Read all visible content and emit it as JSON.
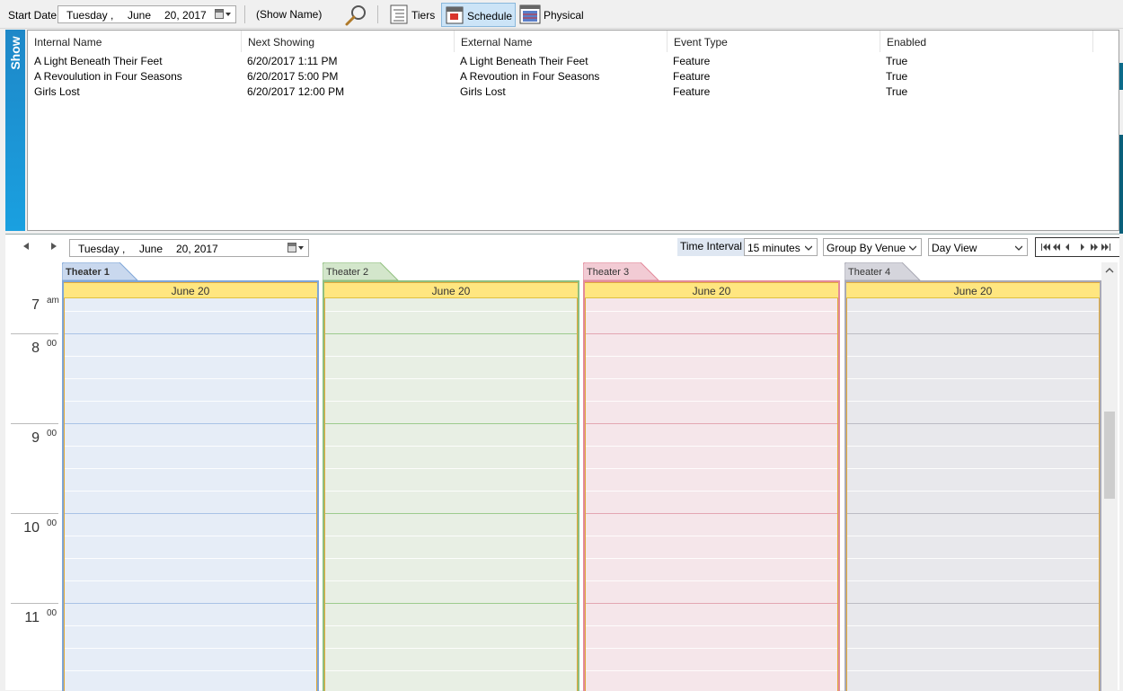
{
  "toolbar": {
    "start_date_label": "Start Date",
    "start_date": {
      "weekday": "Tuesday",
      "sep": ",",
      "month": "June",
      "day_year": "20, 2017"
    },
    "show_name": "(Show Name)",
    "tiers_label": "Tiers",
    "schedule_label": "Schedule",
    "physical_label": "Physical"
  },
  "show_panel": {
    "tab_label": "Show",
    "columns": [
      "Internal Name",
      "Next Showing",
      "External Name",
      "Event Type",
      "Enabled"
    ],
    "rows": [
      [
        "A Light Beneath Their Feet",
        "6/20/2017 1:11 PM",
        "A Light Beneath Their Feet",
        "Feature",
        "True"
      ],
      [
        "A Revoulution in Four Seasons",
        "6/20/2017 5:00 PM",
        "A Revoution in Four Seasons",
        "Feature",
        "True"
      ],
      [
        "Girls Lost",
        "6/20/2017 12:00 PM",
        "Girls Lost",
        "Feature",
        "True"
      ]
    ]
  },
  "scheduler": {
    "date": {
      "weekday": "Tuesday",
      "sep": ",",
      "month": "June",
      "day_year": "20, 2017"
    },
    "time_interval_label": "Time Interval",
    "interval_value": "15 minutes",
    "group_value": "Group By Venue",
    "view_value": "Day View",
    "theaters": [
      {
        "name": "Theater 1",
        "date": "June 20",
        "bg": "#e6edf7",
        "border": "#7fa6d8",
        "line": "#a9c3e6",
        "tab": "#c9d8ee"
      },
      {
        "name": "Theater 2",
        "date": "June 20",
        "bg": "#e8efe4",
        "border": "#8fbf7f",
        "line": "#9ccb8d",
        "tab": "#d3e6cb"
      },
      {
        "name": "Theater 3",
        "date": "June 20",
        "bg": "#f5e6ea",
        "border": "#e38a9a",
        "line": "#e3a6b2",
        "tab": "#f2cbd4"
      },
      {
        "name": "Theater 4",
        "date": "June 20",
        "bg": "#e8e8ec",
        "border": "#a9a9b4",
        "line": "#bcbcc4",
        "tab": "#d5d5dc"
      }
    ],
    "hours": [
      {
        "hour": "7",
        "minutes": "am"
      },
      {
        "hour": "8",
        "minutes": "00"
      },
      {
        "hour": "9",
        "minutes": "00"
      },
      {
        "hour": "10",
        "minutes": "00"
      },
      {
        "hour": "11",
        "minutes": "00"
      }
    ],
    "accent_color": "#e0a83a"
  }
}
